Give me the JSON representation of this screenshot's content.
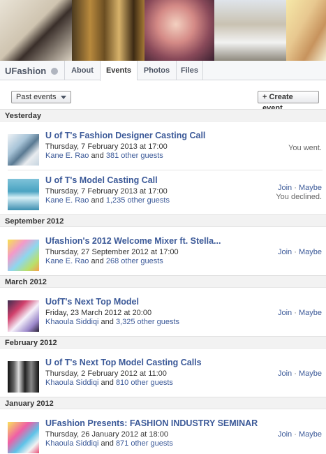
{
  "page": {
    "name": "UFashion",
    "tabs": [
      "About",
      "Events",
      "Photos",
      "Files"
    ],
    "active_tab": "Events"
  },
  "toolbar": {
    "filter_label": "Past events",
    "create_label": "+ Create event"
  },
  "sections": [
    {
      "label": "Yesterday",
      "events": [
        {
          "title": "U of T's Fashion Designer Casting Call",
          "date_text": "Thursday, 7 February 2013",
          "at": "at",
          "time": "17:00",
          "host": "Kane E. Rao",
          "and": "and",
          "guests": "381 other guests",
          "status": "You went."
        },
        {
          "title": "U of T's Model Casting Call",
          "date_text": "Thursday, 7 February 2013",
          "at": "at",
          "time": "17:00",
          "host": "Kane E. Rao",
          "and": "and",
          "guests": "1,235 other guests",
          "join": "Join",
          "sep": " · ",
          "maybe": "Maybe",
          "status": "You declined."
        }
      ]
    },
    {
      "label": "September 2012",
      "events": [
        {
          "title": "Ufashion's 2012 Welcome Mixer ft. Stella...",
          "date_text": "Thursday, 27 September 2012",
          "at": "at",
          "time": "17:00",
          "host": "Kane E. Rao",
          "and": "and",
          "guests": "268 other guests",
          "join": "Join",
          "sep": " · ",
          "maybe": "Maybe"
        }
      ]
    },
    {
      "label": "March 2012",
      "events": [
        {
          "title": "UofT's Next Top Model",
          "date_text": "Friday, 23 March 2012",
          "at": "at",
          "time": "20:00",
          "host": "Khaoula Siddiqi",
          "and": "and",
          "guests": "3,325 other guests",
          "join": "Join",
          "sep": " · ",
          "maybe": "Maybe"
        }
      ]
    },
    {
      "label": "February 2012",
      "events": [
        {
          "title": "U of T's Next Top Model Casting Calls",
          "date_text": "Thursday, 2 February 2012",
          "at": "at",
          "time": "11:00",
          "host": "Khaoula Siddiqi",
          "and": "and",
          "guests": "810 other guests",
          "join": "Join",
          "sep": " · ",
          "maybe": "Maybe"
        }
      ]
    },
    {
      "label": "January 2012",
      "events": [
        {
          "title": "UFashion Presents: FASHION INDUSTRY SEMINAR",
          "date_text": "Thursday, 26 January 2012",
          "at": "at",
          "time": "18:00",
          "host": "Khaoula Siddiqi",
          "and": "and",
          "guests": "871 other guests",
          "join": "Join",
          "sep": " · ",
          "maybe": "Maybe"
        }
      ]
    }
  ],
  "colors": {
    "link": "#3b5998",
    "section_bg": "#f2f2f2",
    "tab_bar_bg": "#f6f7f9"
  },
  "icons": [
    "globe-icon",
    "chevron-down-icon"
  ]
}
